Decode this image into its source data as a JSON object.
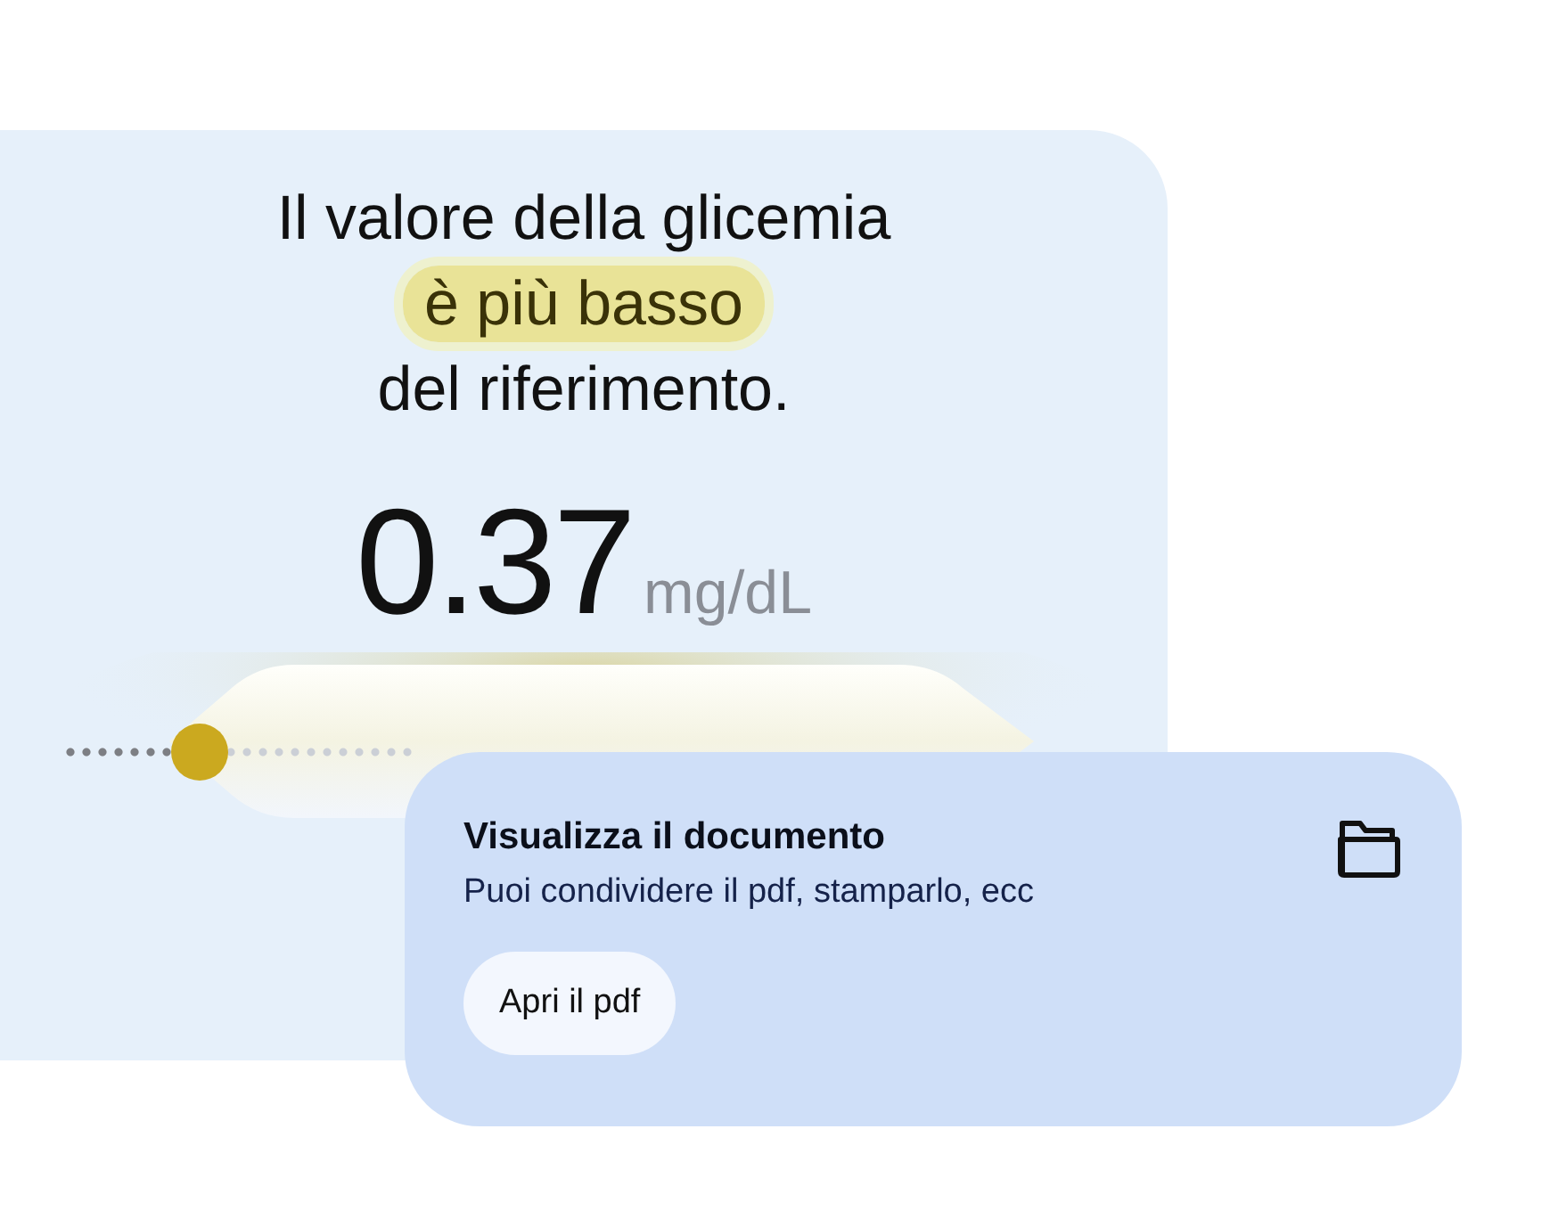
{
  "result_card": {
    "heading": {
      "before": "Il valore della glicemia",
      "highlight": "è più basso",
      "after": "del riferimento."
    },
    "value": "0.37",
    "unit": "mg/dL",
    "gauge": {
      "level": 0.39
    }
  },
  "document_card": {
    "title": "Visualizza il documento",
    "subtitle": "Puoi condividere il pdf, stamparlo, ecc",
    "button": "Apri il pdf"
  }
}
